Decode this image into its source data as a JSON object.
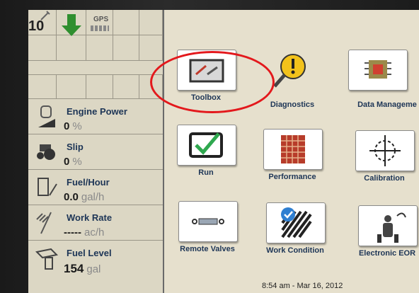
{
  "status": {
    "signal_value": "10",
    "gps_label": "GPS",
    "datetime": "8:54 am - Mar 16, 2012"
  },
  "stats": [
    {
      "label": "Engine Power",
      "value": "0",
      "unit": "%"
    },
    {
      "label": "Slip",
      "value": "0",
      "unit": "%"
    },
    {
      "label": "Fuel/Hour",
      "value": "0.0",
      "unit": "gal/h"
    },
    {
      "label": "Work Rate",
      "value": "-----",
      "unit": "ac/h"
    },
    {
      "label": "Fuel Level",
      "value": "154",
      "unit": "gal"
    }
  ],
  "menu": [
    {
      "label": "Toolbox",
      "icon": "toolbox-icon"
    },
    {
      "label": "Diagnostics",
      "icon": "diagnostics-icon"
    },
    {
      "label": "Data Manageme",
      "icon": "data-management-icon"
    },
    {
      "label": "Run",
      "icon": "run-icon"
    },
    {
      "label": "Performance",
      "icon": "performance-icon"
    },
    {
      "label": "Calibration",
      "icon": "calibration-icon"
    },
    {
      "label": "Remote Valves",
      "icon": "remote-valves-icon"
    },
    {
      "label": "Work Condition",
      "icon": "work-condition-icon"
    },
    {
      "label": "Electronic EOR",
      "icon": "electronic-eor-icon"
    }
  ],
  "colors": {
    "highlight": "#e3181c",
    "label_blue": "#1d3556",
    "screen_bg": "#e6e0cd",
    "check_green": "#2fa84f",
    "arrow_green": "#2f8f2f"
  }
}
